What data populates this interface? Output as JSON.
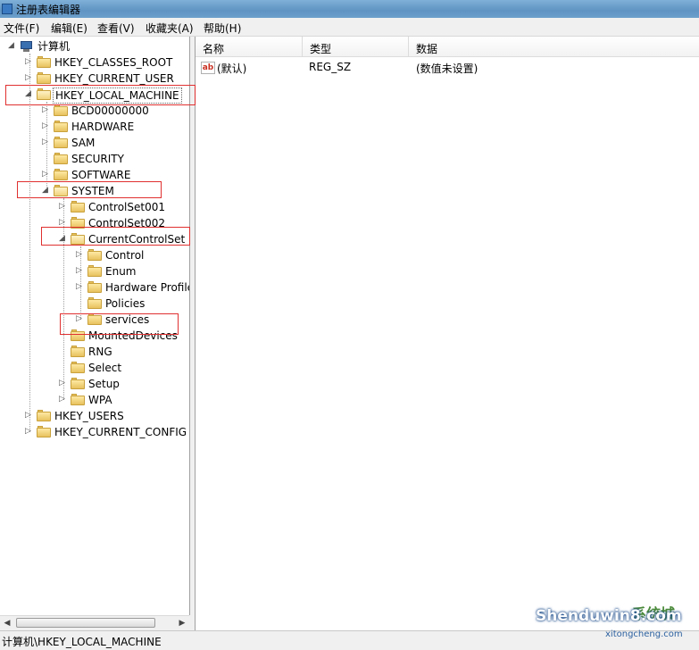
{
  "window": {
    "title": "注册表编辑器"
  },
  "menu": [
    "文件(F)",
    "编辑(E)",
    "查看(V)",
    "收藏夹(A)",
    "帮助(H)"
  ],
  "tree": {
    "root": "计算机",
    "nodes": [
      "HKEY_CLASSES_ROOT",
      "HKEY_CURRENT_USER",
      "HKEY_LOCAL_MACHINE",
      "BCD00000000",
      "HARDWARE",
      "SAM",
      "SECURITY",
      "SOFTWARE",
      "SYSTEM",
      "ControlSet001",
      "ControlSet002",
      "CurrentControlSet",
      "Control",
      "Enum",
      "Hardware Profiles",
      "Policies",
      "services",
      "MountedDevices",
      "RNG",
      "Select",
      "Setup",
      "WPA",
      "HKEY_USERS",
      "HKEY_CURRENT_CONFIG"
    ]
  },
  "list": {
    "columns": [
      "名称",
      "类型",
      "数据"
    ],
    "rows": [
      {
        "name": "(默认)",
        "type": "REG_SZ",
        "data": "(数值未设置)",
        "icon": "ab-icon"
      }
    ]
  },
  "status": {
    "path": "计算机\\HKEY_LOCAL_MACHINE"
  },
  "watermark": {
    "main": "Shenduwin8.com",
    "sub": "xitongcheng.com",
    "cn": "系统城"
  },
  "colors": {
    "highlight_box": "#e03030",
    "titlebar": "#6c9fcb",
    "folder": "#e8c25e"
  }
}
